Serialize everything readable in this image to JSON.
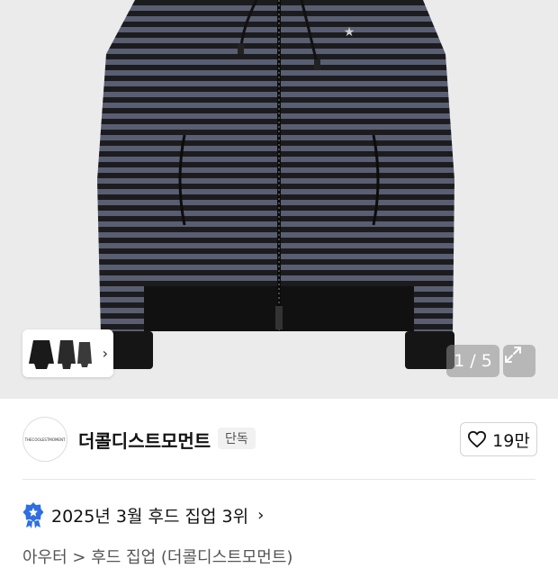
{
  "gallery": {
    "counter": "1 / 5",
    "thumbnail_count": 3,
    "colors": {
      "stripe_dark": "#1c1c1f",
      "stripe_light": "#5a5e72",
      "background": "#ebebeb"
    }
  },
  "shop": {
    "logo_text": "THECOOLESTMOMENT",
    "name": "더콜디스트모먼트",
    "badge": "단독",
    "likes": "19만"
  },
  "ranking": {
    "text": "2025년 3월 후드 집업 3위"
  },
  "breadcrumb": {
    "text": "아우터 > 후드 집업 (더콜디스트모먼트)"
  }
}
